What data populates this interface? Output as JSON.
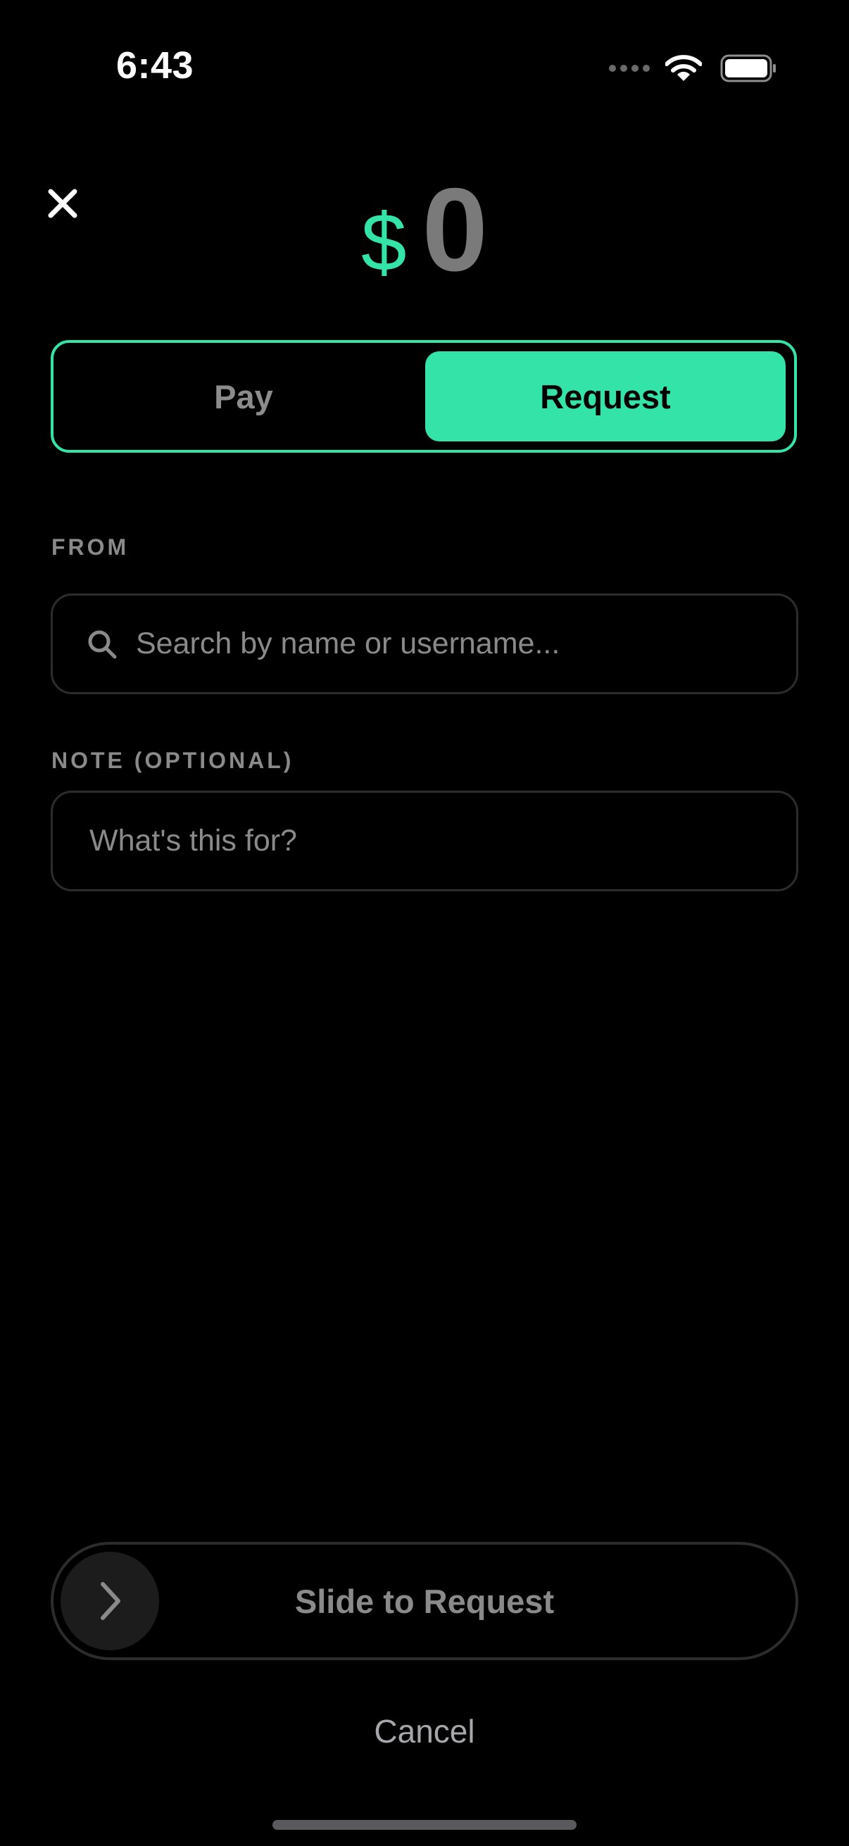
{
  "status_bar": {
    "time": "6:43",
    "icons": [
      "cellular-signal-icon",
      "wifi-icon",
      "battery-icon"
    ]
  },
  "header": {
    "close_icon": "close-icon",
    "currency_symbol": "$",
    "amount": "0"
  },
  "mode_toggle": {
    "options": [
      "Pay",
      "Request"
    ],
    "selected": "Request"
  },
  "from_field": {
    "label": "FROM",
    "placeholder": "Search by name or username...",
    "value": "",
    "icon": "search-icon"
  },
  "note_field": {
    "label": "NOTE (OPTIONAL)",
    "placeholder": "What's this for?",
    "value": ""
  },
  "slider": {
    "label": "Slide to Request",
    "knob_icon": "chevron-right-icon"
  },
  "cancel_label": "Cancel",
  "colors": {
    "background": "#000000",
    "accent": "#33e3a8",
    "muted_text": "#8a8a8a",
    "border": "#2c2c2c"
  }
}
